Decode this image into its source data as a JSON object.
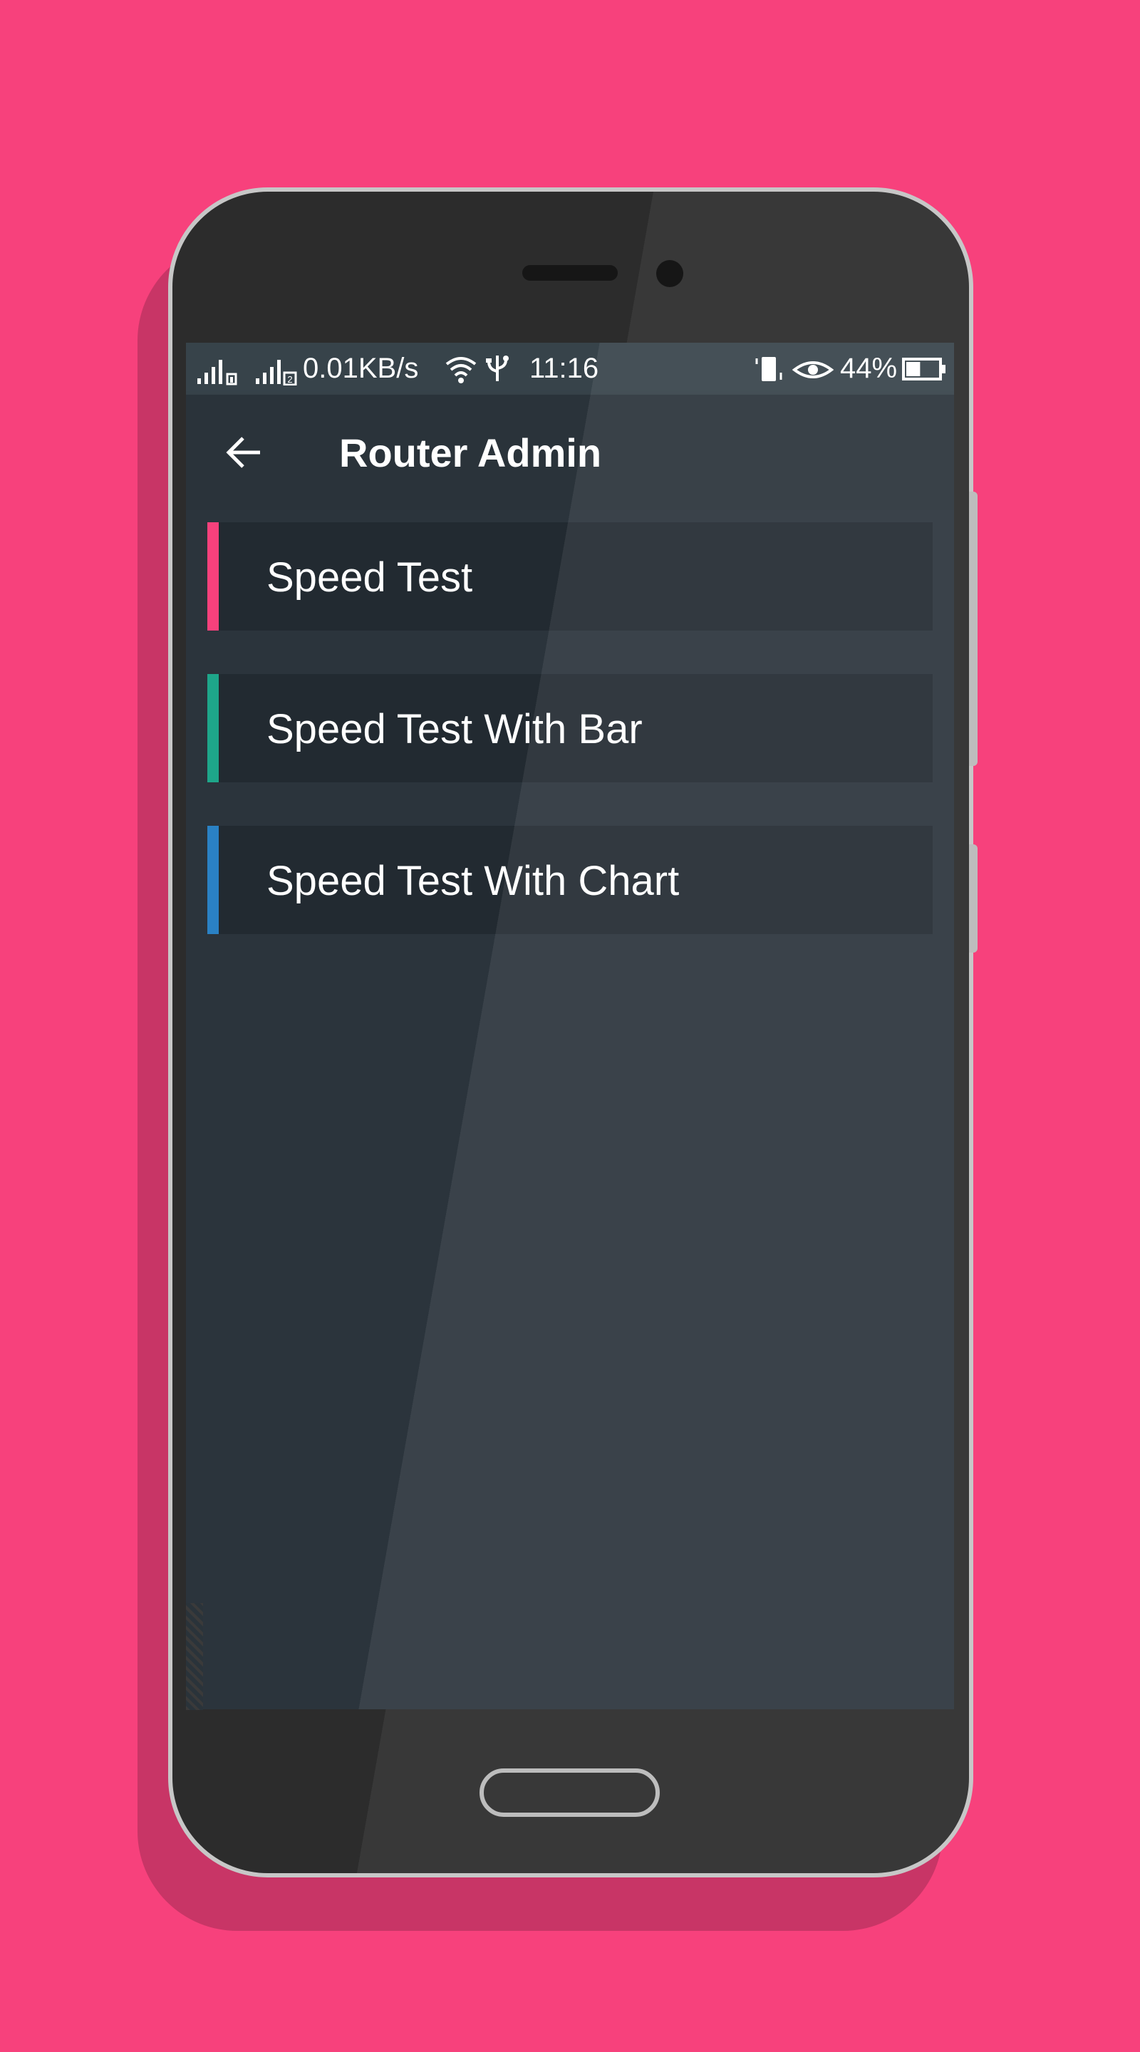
{
  "status_bar": {
    "network_speed": "0.01KB/s",
    "time": "11:16",
    "battery_percent": "44%",
    "battery_level": 0.44,
    "sim2_label": "2",
    "icons": [
      "signal-sim1-icon",
      "signal-sim2-icon",
      "wifi-icon",
      "usb-icon",
      "vibrate-icon",
      "eye-comfort-icon",
      "battery-icon"
    ]
  },
  "app_bar": {
    "title": "Router Admin",
    "back_icon": "arrow-left-icon"
  },
  "menu": {
    "items": [
      {
        "label": "Speed Test",
        "accent": "#f7417c"
      },
      {
        "label": "Speed Test With Bar",
        "accent": "#1ea68a"
      },
      {
        "label": "Speed Test With Chart",
        "accent": "#2a81c4"
      }
    ]
  },
  "colors": {
    "background": "#f7417c",
    "screen": "#2b343c",
    "item": "#222a31",
    "status_bar": "#37434a"
  }
}
